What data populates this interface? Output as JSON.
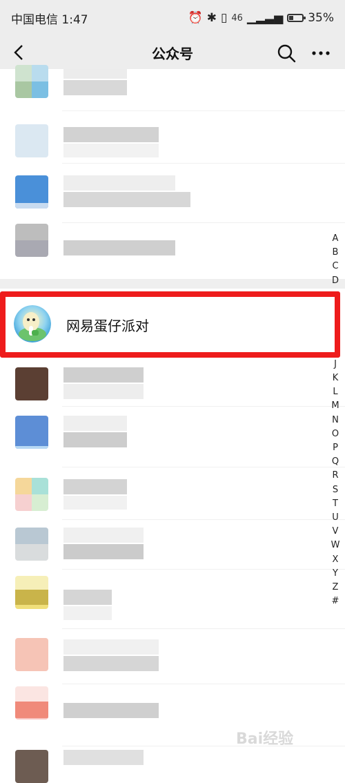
{
  "status": {
    "carrier_time": "中国电信 1:47",
    "net_label": "46",
    "battery": "35%"
  },
  "navbar": {
    "title": "公众号",
    "icons": [
      "chevron-left-icon",
      "search-icon",
      "more-icon"
    ]
  },
  "highlighted_account": {
    "name": "网易蛋仔派对",
    "highlight_color": "#ee1c1c"
  },
  "index_letters": [
    "A",
    "B",
    "C",
    "D",
    "",
    "",
    "",
    "",
    "",
    "J",
    "K",
    "L",
    "M",
    "N",
    "O",
    "P",
    "Q",
    "R",
    "S",
    "T",
    "U",
    "V",
    "W",
    "X",
    "Y",
    "Z",
    "#"
  ],
  "watermark": "Bai经验"
}
